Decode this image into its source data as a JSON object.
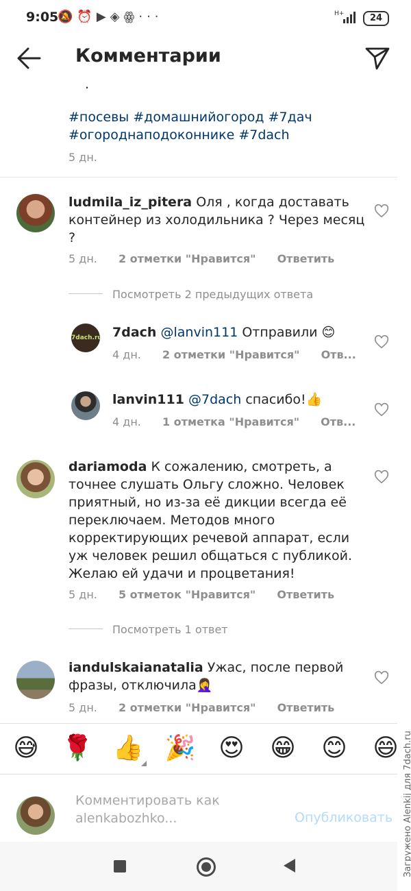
{
  "status_bar": {
    "time": "9:05",
    "network": "H+",
    "battery": "24"
  },
  "header": {
    "title": "Комментарии"
  },
  "post": {
    "fragment": ".",
    "hashtags": "#посевы #домашнийогород #7дач #огороднаподоконнике #7dach",
    "time": "5 дн."
  },
  "comments": [
    {
      "user": "ludmila_iz_pitera",
      "text": "Оля , когда доставать контейнер из холодильника ? Через месяц ?",
      "time": "5 дн.",
      "likes": "2 отметки \"Нравится\"",
      "reply": "Ответить"
    },
    {
      "user": "dariamoda",
      "text": "К сожалению, смотреть, а точнее слушать Ольгу сложно. Человек приятный, но из-за её дикции всегда её переключаем. Методов много корректирующих речевой аппарат, если уж человек решил общаться с публикой. Желаю ей удачи и процветания!",
      "time": "5 дн.",
      "likes": "5 отметок \"Нравится\"",
      "reply": "Ответить"
    },
    {
      "user": "iandulskaianatalia",
      "text": "Ужас, после первой фразы, отключила🤦‍♀️",
      "time": "5 дн.",
      "likes": "2 отметки \"Нравится\"",
      "reply": "Ответить"
    }
  ],
  "view_previous": "Посмотреть 2 предыдущих ответа",
  "view_one": "Посмотреть 1 ответ",
  "replies": [
    {
      "user": "7dach",
      "avatar_text": "7dach.ru",
      "mention": "@lanvin111",
      "text": "Отправили 😊",
      "time": "4 дн.",
      "likes": "2 отметки \"Нравится\"",
      "reply": "Отв..."
    },
    {
      "user": "lanvin111",
      "mention": "@7dach",
      "text": "спасибо!👍",
      "time": "4 дн.",
      "likes": "1 отметка \"Нравится\"",
      "reply": "Отв..."
    }
  ],
  "emoji_bar": [
    "😅",
    "🌹",
    "👍",
    "🎉",
    "😍",
    "😁",
    "😊",
    "😄"
  ],
  "composer": {
    "placeholder": "Комментировать как alenkabozhko...",
    "publish": "Опубликовать"
  },
  "watermark": "Загружено Alenkij для 7dach.ru",
  "colors": {
    "link": "#00376b",
    "muted": "#8e8e8e",
    "publish_disabled": "#b3dbff"
  }
}
